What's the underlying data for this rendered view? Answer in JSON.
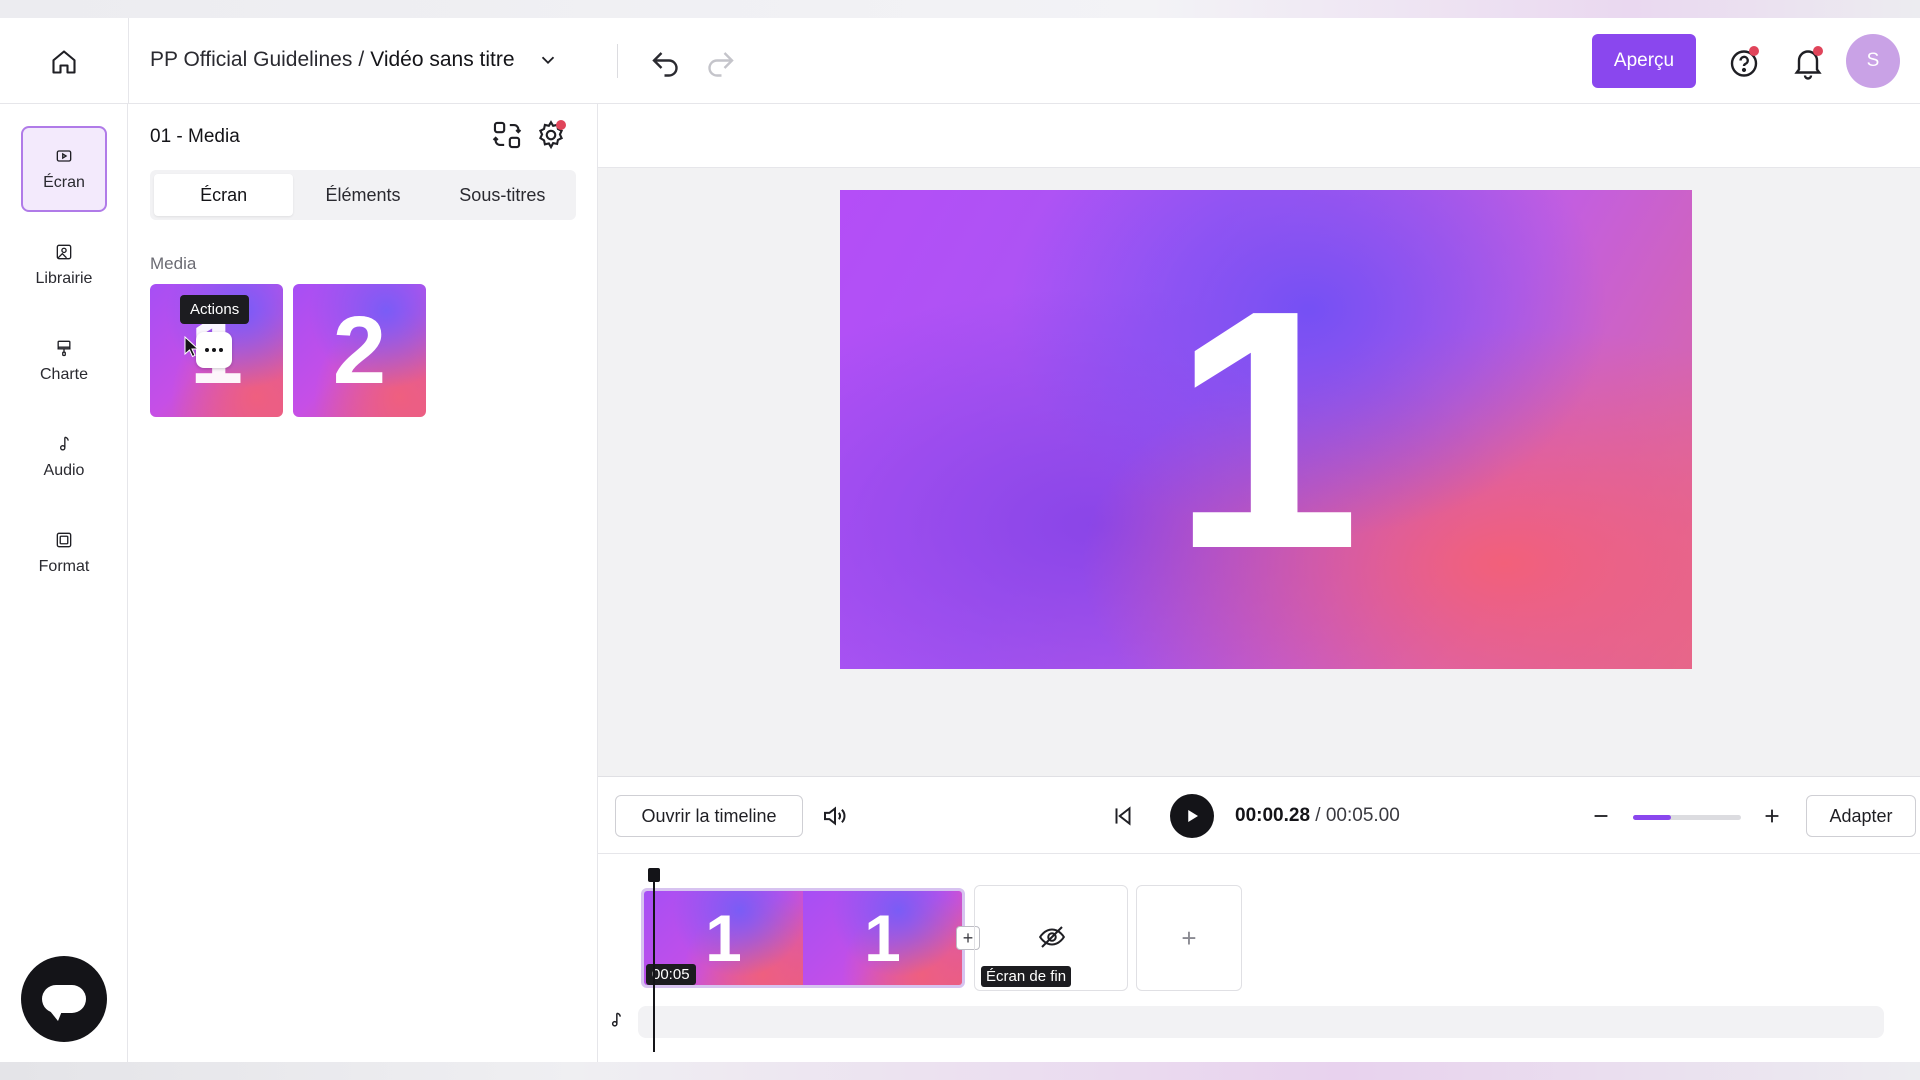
{
  "header": {
    "workspace": "PP Official Guidelines",
    "separator": "/",
    "video_title": "Vidéo sans titre",
    "preview_label": "Aperçu",
    "avatar_initial": "S"
  },
  "sidebar": {
    "items": [
      {
        "label": "Écran",
        "icon": "screen-icon",
        "active": true
      },
      {
        "label": "Librairie",
        "icon": "library-icon",
        "active": false
      },
      {
        "label": "Charte",
        "icon": "brush-icon",
        "active": false
      },
      {
        "label": "Audio",
        "icon": "music-note-icon",
        "active": false
      },
      {
        "label": "Format",
        "icon": "frame-icon",
        "active": false
      }
    ]
  },
  "panel": {
    "title": "01 - Media",
    "tabs": [
      {
        "label": "Écran",
        "active": true
      },
      {
        "label": "Éléments",
        "active": false
      },
      {
        "label": "Sous-titres",
        "active": false
      }
    ],
    "section_label": "Media",
    "thumbnails": [
      {
        "number": "1"
      },
      {
        "number": "2"
      }
    ],
    "tooltip": "Actions"
  },
  "preview": {
    "number": "1"
  },
  "controls": {
    "open_timeline_label": "Ouvrir la timeline",
    "current_time": "00:00.28",
    "time_separator": " / ",
    "total_time": "00:05.00",
    "zoom_level": 0.35,
    "fit_label": "Adapter"
  },
  "timeline": {
    "clip_frames": [
      "1",
      "1"
    ],
    "clip_duration": "00:05",
    "end_card_label": "Écran de fin",
    "add_symbol": "+",
    "insert_symbol": "+"
  },
  "colors": {
    "accent": "#8a47ee",
    "notification": "#e0445a"
  }
}
